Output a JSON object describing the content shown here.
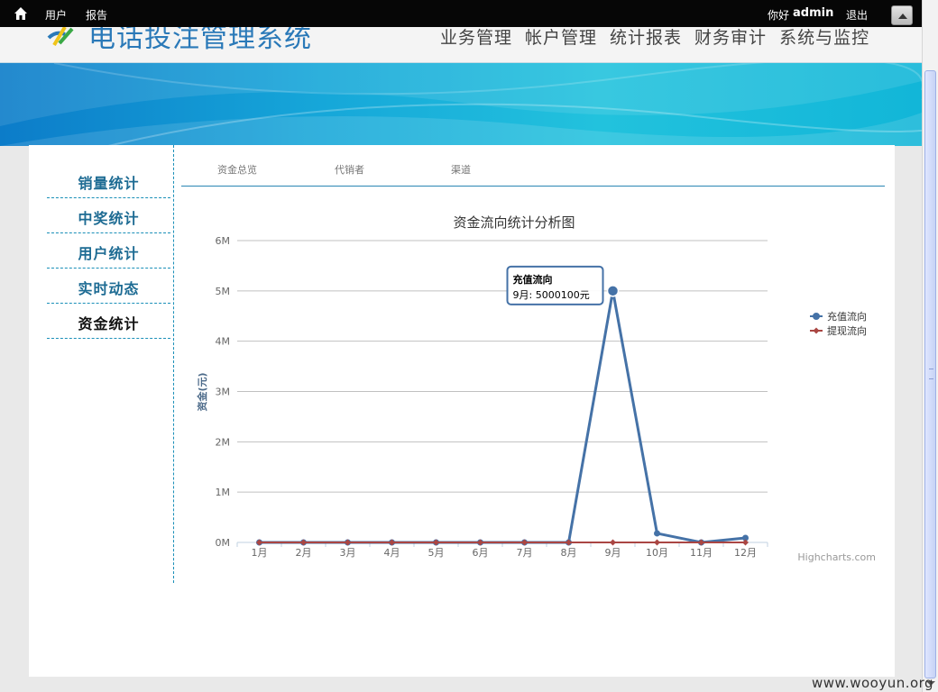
{
  "topbar": {
    "nav": [
      "用户",
      "报告"
    ],
    "greeting": "你好",
    "username": "admin",
    "logout": "退出"
  },
  "header": {
    "system_title": "电话投注管理系统",
    "main_nav": [
      "业务管理",
      "帐户管理",
      "统计报表",
      "财务审计",
      "系统与监控"
    ]
  },
  "sidebar": {
    "items": [
      {
        "label": "销量统计",
        "active": false
      },
      {
        "label": "中奖统计",
        "active": false
      },
      {
        "label": "用户统计",
        "active": false
      },
      {
        "label": "实时动态",
        "active": false
      },
      {
        "label": "资金统计",
        "active": true
      }
    ]
  },
  "tabs": [
    "资金总览",
    "代销者",
    "渠道"
  ],
  "chart_data": {
    "type": "line",
    "title": "资金流向统计分析图",
    "ylabel": "资金(元)",
    "xlabel": "",
    "categories": [
      "1月",
      "2月",
      "3月",
      "4月",
      "5月",
      "6月",
      "7月",
      "8月",
      "9月",
      "10月",
      "11月",
      "12月"
    ],
    "ylim": [
      0,
      6000000
    ],
    "yticks": [
      "0M",
      "1M",
      "2M",
      "3M",
      "4M",
      "5M",
      "6M"
    ],
    "grid": true,
    "legend_position": "right",
    "series": [
      {
        "name": "充值流向",
        "color": "#4572a7",
        "values": [
          0,
          0,
          0,
          0,
          0,
          0,
          0,
          0,
          5000100,
          180000,
          0,
          90000
        ]
      },
      {
        "name": "提现流向",
        "color": "#aa4643",
        "values": [
          0,
          0,
          0,
          0,
          0,
          0,
          0,
          0,
          0,
          0,
          0,
          0
        ]
      }
    ],
    "tooltip": {
      "series": "充值流向",
      "text": "9月: 5000100元"
    },
    "credits": "Highcharts.com"
  },
  "watermark": "www.wooyun.org"
}
